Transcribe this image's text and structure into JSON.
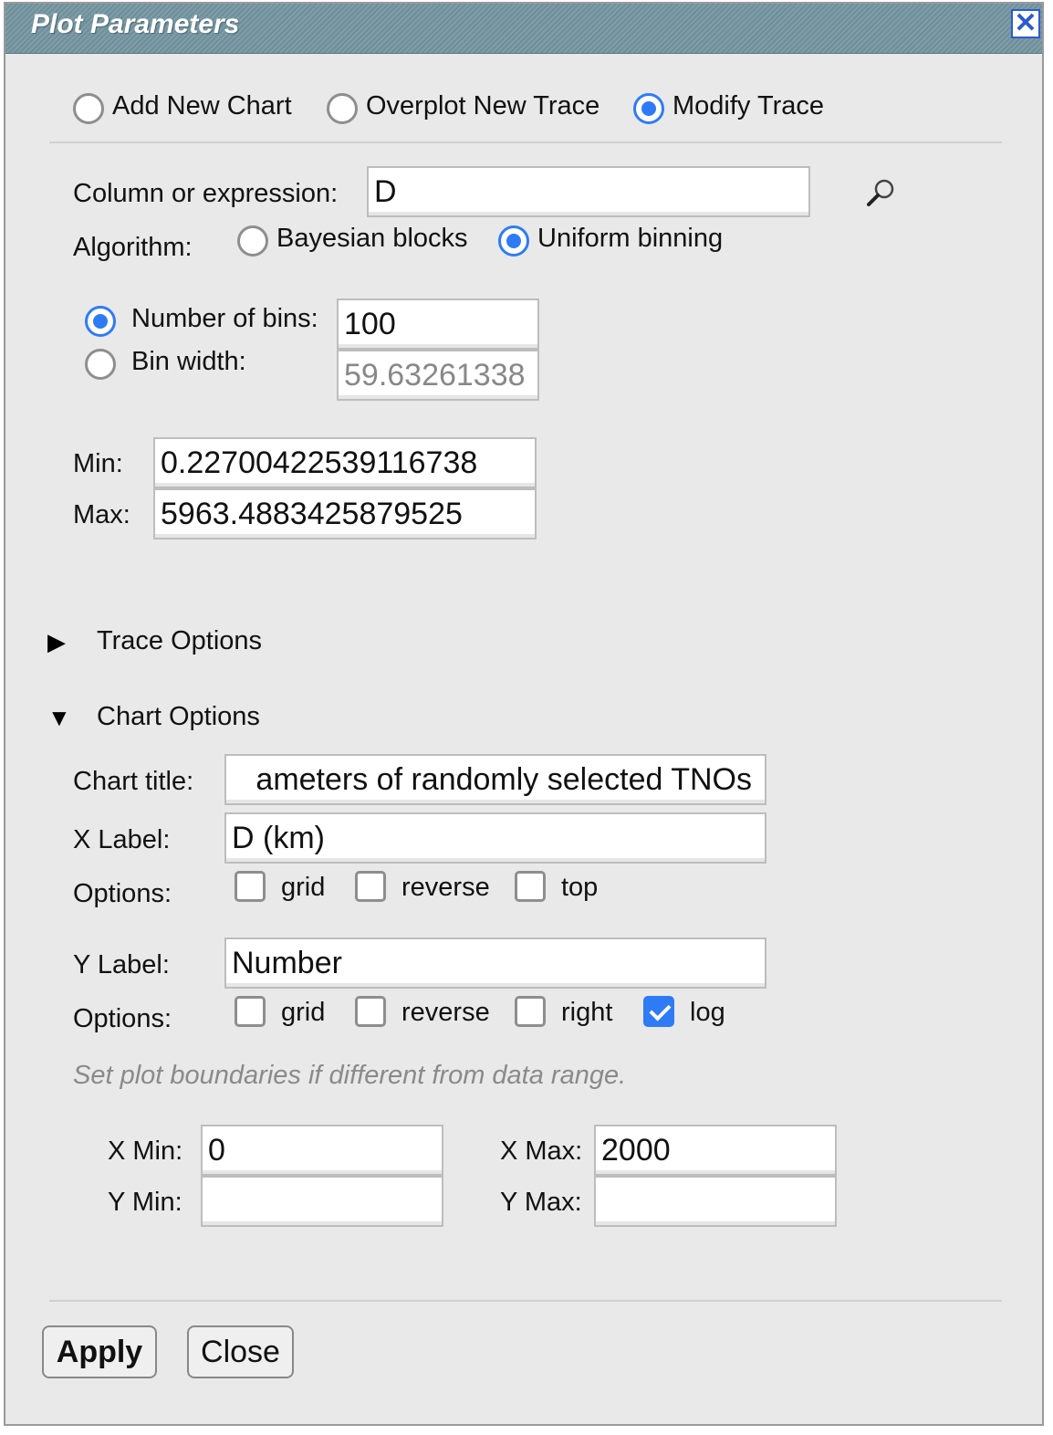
{
  "dialog": {
    "title": "Plot Parameters",
    "close_glyph": "✕"
  },
  "mode": {
    "add_new_chart": "Add New Chart",
    "overplot_new_trace": "Overplot New Trace",
    "modify_trace": "Modify Trace",
    "selected": "modify_trace"
  },
  "column": {
    "label": "Column or expression:",
    "value": "D"
  },
  "algorithm": {
    "label": "Algorithm:",
    "bayesian": "Bayesian blocks",
    "uniform": "Uniform binning",
    "selected": "uniform"
  },
  "bins": {
    "num_label": "Number of bins:",
    "num_value": "100",
    "width_label": "Bin width:",
    "width_value": "59.63261338",
    "selected": "num"
  },
  "range": {
    "min_label": "Min:",
    "min_value": "0.22700422539116738",
    "max_label": "Max:",
    "max_value": "5963.4883425879525"
  },
  "trace_options": {
    "label": "Trace Options",
    "expanded": false,
    "glyph": "▶"
  },
  "chart_options": {
    "label": "Chart Options",
    "expanded": true,
    "glyph": "▼",
    "title_label": "Chart title:",
    "title_value": "ameters of randomly selected TNOs",
    "xlabel_label": "X Label:",
    "xlabel_value": "D (km)",
    "xoptions_label": "Options:",
    "x_grid": "grid",
    "x_reverse": "reverse",
    "x_top": "top",
    "ylabel_label": "Y Label:",
    "ylabel_value": "Number",
    "yoptions_label": "Options:",
    "y_grid": "grid",
    "y_reverse": "reverse",
    "y_right": "right",
    "y_log": "log",
    "hint": "Set plot boundaries if different from data range.",
    "xmin_label": "X Min:",
    "xmin_value": "0",
    "xmax_label": "X Max:",
    "xmax_value": "2000",
    "ymin_label": "Y Min:",
    "ymin_value": "",
    "ymax_label": "Y Max:",
    "ymax_value": ""
  },
  "buttons": {
    "apply": "Apply",
    "close": "Close"
  },
  "colors": {
    "accent": "#2f7bf6",
    "titlebar": "#7e9da8",
    "panel": "#e9e9e9"
  },
  "icons": {
    "search": "magnifier-icon"
  }
}
